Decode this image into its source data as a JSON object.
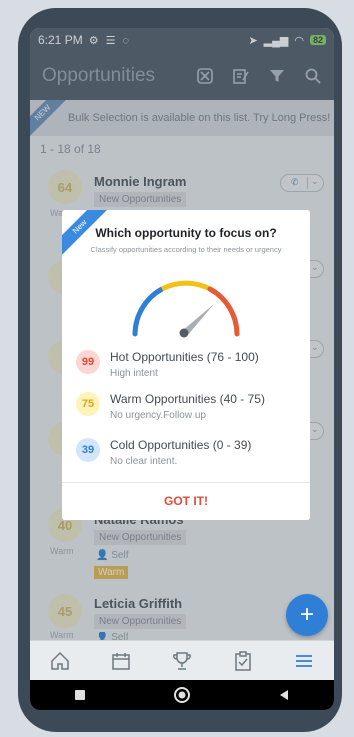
{
  "status": {
    "time": "6:21 PM",
    "battery": "82"
  },
  "appbar": {
    "title": "Opportunities"
  },
  "banner": {
    "ribbon": "NEW",
    "text": "Bulk Selection is available on this list. Try Long Press!"
  },
  "list": {
    "count": "1 - 18 of 18",
    "cards": [
      {
        "score": "64",
        "name": "Monnie Ingram",
        "tag": "New Opportunities",
        "label": "Warm"
      },
      {
        "score": "40",
        "name": "Natalie Ramos",
        "tag": "New Opportunities",
        "label": "Warm",
        "owner": "Self",
        "temp": "Warm"
      },
      {
        "score": "45",
        "name": "Leticia Griffith",
        "tag": "New Opportunities",
        "label": "Warm",
        "owner": "Self"
      }
    ]
  },
  "dialog": {
    "ribbon": "New",
    "title": "Which opportunity to focus on?",
    "subtitle": "Classify opportunities according to their needs or urgency",
    "tiers": [
      {
        "score": "99",
        "title": "Hot Opportunities (76 - 100)",
        "desc": "High intent",
        "bg": "#fbd7d3",
        "fg": "#e0493a"
      },
      {
        "score": "75",
        "title": "Warm Opportunities (40 - 75)",
        "desc": "No urgency.Follow up",
        "bg": "#fff3b8",
        "fg": "#d6a820"
      },
      {
        "score": "39",
        "title": "Cold Opportunities (0 - 39)",
        "desc": "No clear intent.",
        "bg": "#d3e6fb",
        "fg": "#2f7fd6"
      }
    ],
    "button": "GOT IT!"
  },
  "fab": {
    "label": "+"
  },
  "colors": {
    "appbar": "#3d4c59",
    "accent": "#2f7fd6",
    "gotit": "#e14b3b"
  }
}
